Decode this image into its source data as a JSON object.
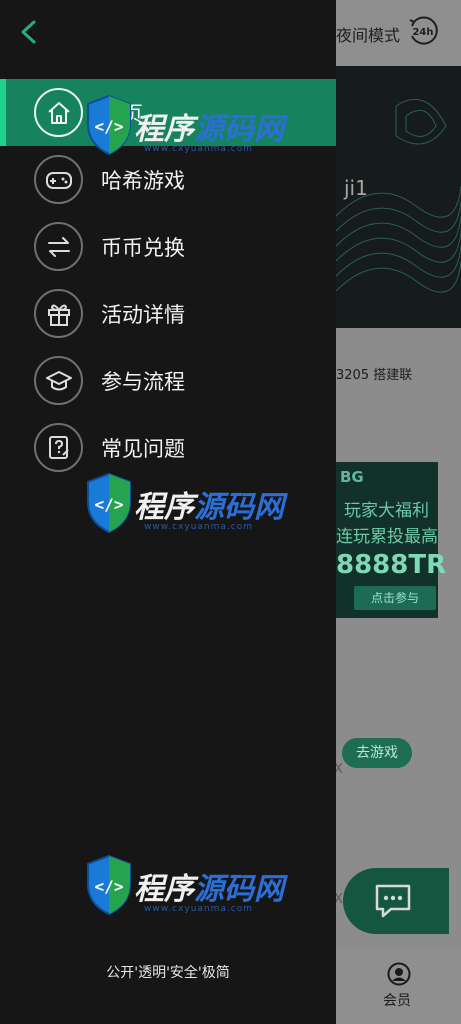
{
  "background": {
    "night_mode_label": "夜间模式",
    "clock_badge": "24h",
    "banner_text": "ji1",
    "sub_line": "3205  搭建联",
    "promo": {
      "brand": "BG",
      "line1": "玩家大福利",
      "line2": "连玩累投最高",
      "amount": "8888TR",
      "button": "点击参与"
    },
    "go_game_button": "去游戏",
    "x_mark": "X",
    "member_label": "会员"
  },
  "drawer": {
    "menu": [
      {
        "label": "首页",
        "icon": "home-icon",
        "active": true
      },
      {
        "label": "哈希游戏",
        "icon": "gamepad-icon",
        "active": false
      },
      {
        "label": "币币兑换",
        "icon": "exchange-icon",
        "active": false
      },
      {
        "label": "活动详情",
        "icon": "gift-icon",
        "active": false
      },
      {
        "label": "参与流程",
        "icon": "graduation-cap-icon",
        "active": false
      },
      {
        "label": "常见问题",
        "icon": "question-doc-icon",
        "active": false
      }
    ],
    "footer": "公开'透明'安全'极简"
  },
  "watermark": {
    "text_a": "程序",
    "text_b": "源码网",
    "url": "www.cxyuanma.com"
  },
  "colors": {
    "drawer_bg": "#161616",
    "active_bg": "#16825e",
    "accent": "#1fd08a"
  }
}
